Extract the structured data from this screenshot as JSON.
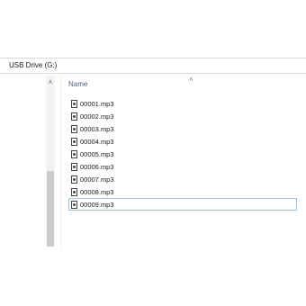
{
  "address_bar": {
    "path": "USB Drive (G:)"
  },
  "file_list": {
    "column_header": "Name",
    "files": [
      {
        "name": "00001.mp3",
        "icon": "audio-file-icon"
      },
      {
        "name": "00002.mp3",
        "icon": "audio-file-icon"
      },
      {
        "name": "00003.mp3",
        "icon": "audio-file-icon"
      },
      {
        "name": "00004.mp3",
        "icon": "audio-file-icon"
      },
      {
        "name": "00005.mp3",
        "icon": "audio-file-icon"
      },
      {
        "name": "00006.mp3",
        "icon": "audio-file-icon"
      },
      {
        "name": "00007.mp3",
        "icon": "audio-file-icon"
      },
      {
        "name": "00008.mp3",
        "icon": "audio-file-icon"
      },
      {
        "name": "00009.mp3",
        "icon": "audio-file-icon",
        "selected": true
      }
    ]
  },
  "icons": {
    "scroll_up": "scroll-up-icon",
    "sort": "sort-ascending-icon"
  },
  "colors": {
    "selection_border": "#99c7ea",
    "header_text": "#4d6082"
  }
}
